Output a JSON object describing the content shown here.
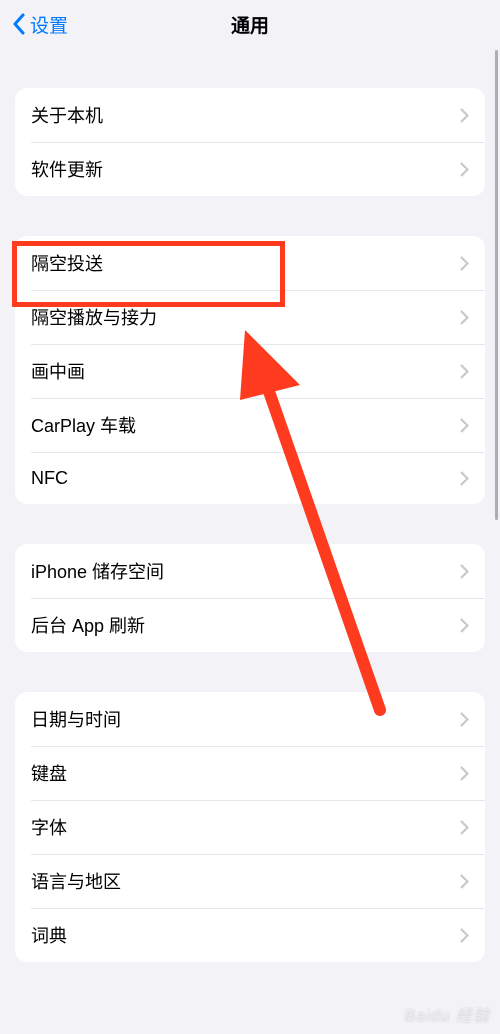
{
  "header": {
    "back_label": "设置",
    "title": "通用"
  },
  "groups": [
    {
      "items": [
        {
          "label": "关于本机"
        },
        {
          "label": "软件更新"
        }
      ]
    },
    {
      "items": [
        {
          "label": "隔空投送",
          "highlighted": true
        },
        {
          "label": "隔空播放与接力"
        },
        {
          "label": "画中画"
        },
        {
          "label": "CarPlay 车载"
        },
        {
          "label": "NFC"
        }
      ]
    },
    {
      "items": [
        {
          "label": "iPhone 储存空间"
        },
        {
          "label": "后台 App 刷新"
        }
      ]
    },
    {
      "items": [
        {
          "label": "日期与时间"
        },
        {
          "label": "键盘"
        },
        {
          "label": "字体"
        },
        {
          "label": "语言与地区"
        },
        {
          "label": "词典"
        }
      ]
    }
  ],
  "annotation": {
    "highlight_color": "#ff3b1f",
    "arrow_color": "#ff3b1f"
  },
  "watermark": "Baidu 经验"
}
